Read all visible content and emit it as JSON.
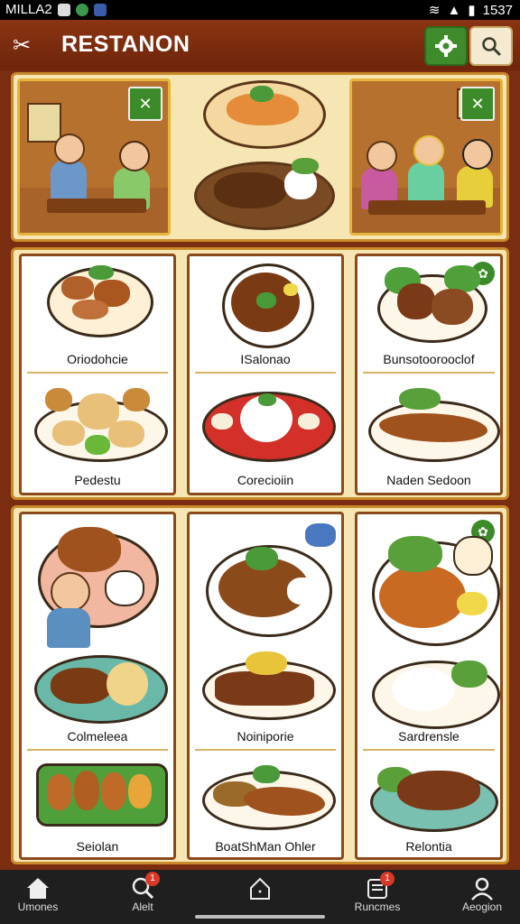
{
  "status_bar": {
    "carrier": "MILLA2",
    "time": "1537"
  },
  "app": {
    "title": "RESTANON"
  },
  "panel1": [
    {
      "top": "Oriodohcie",
      "bottom": "Pedestu"
    },
    {
      "top": "ISalonao",
      "bottom": "Corecioiin"
    },
    {
      "top": "Bunsotoorooclof",
      "bottom": "Naden Sedoon"
    }
  ],
  "panel2": [
    {
      "top": "Colmeleea",
      "bottom": "Seiolan"
    },
    {
      "top": "Noiniporie",
      "bottom": "BoatShMan Ohler"
    },
    {
      "top": "Sardrensle",
      "bottom": "Relontia"
    }
  ],
  "nav": [
    {
      "label": "Umones",
      "icon": "home-icon",
      "badge": ""
    },
    {
      "label": "Alelt",
      "icon": "search-icon",
      "badge": "1"
    },
    {
      "label": "",
      "icon": "house-outline-icon",
      "badge": ""
    },
    {
      "label": "Runcmes",
      "icon": "list-icon",
      "badge": "1"
    },
    {
      "label": "Aeogion",
      "icon": "profile-icon",
      "badge": ""
    }
  ],
  "colors": {
    "brand": "#7a2d10",
    "accent_green": "#3d8a2a",
    "cream": "#f6e6b4",
    "border": "#c88a2a"
  }
}
